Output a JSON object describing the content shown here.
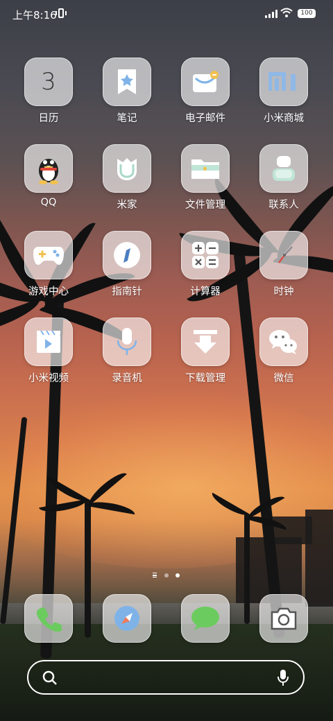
{
  "status_bar": {
    "time": "上午8:16",
    "battery": "100"
  },
  "apps": [
    {
      "label": "日历",
      "icon": "calendar-icon",
      "badge_text": "3"
    },
    {
      "label": "笔记",
      "icon": "notes-icon"
    },
    {
      "label": "电子邮件",
      "icon": "email-icon"
    },
    {
      "label": "小米商城",
      "icon": "mi-store-icon"
    },
    {
      "label": "QQ",
      "icon": "qq-penguin-icon"
    },
    {
      "label": "米家",
      "icon": "mijia-icon"
    },
    {
      "label": "文件管理",
      "icon": "folder-icon"
    },
    {
      "label": "联系人",
      "icon": "contacts-icon"
    },
    {
      "label": "游戏中心",
      "icon": "gamepad-icon"
    },
    {
      "label": "指南针",
      "icon": "compass-icon"
    },
    {
      "label": "计算器",
      "icon": "calculator-icon"
    },
    {
      "label": "时钟",
      "icon": "clock-icon"
    },
    {
      "label": "小米视频",
      "icon": "video-icon"
    },
    {
      "label": "录音机",
      "icon": "microphone-icon"
    },
    {
      "label": "下载管理",
      "icon": "download-icon"
    },
    {
      "label": "微信",
      "icon": "wechat-icon"
    }
  ],
  "page_indicator": {
    "pages": 3,
    "active": 2
  },
  "dock": [
    {
      "name": "phone",
      "icon": "phone-icon"
    },
    {
      "name": "browser",
      "icon": "compass-browser-icon"
    },
    {
      "name": "messages",
      "icon": "message-bubble-icon"
    },
    {
      "name": "camera",
      "icon": "camera-icon"
    }
  ],
  "search": {
    "icon": "search-icon",
    "voice_icon": "microphone-icon"
  },
  "colors": {
    "icon_tile": "#e9eaee",
    "accent_blue": "#7fb3e8",
    "accent_green": "#6ccb5f",
    "accent_yellow": "#f2c14e"
  }
}
